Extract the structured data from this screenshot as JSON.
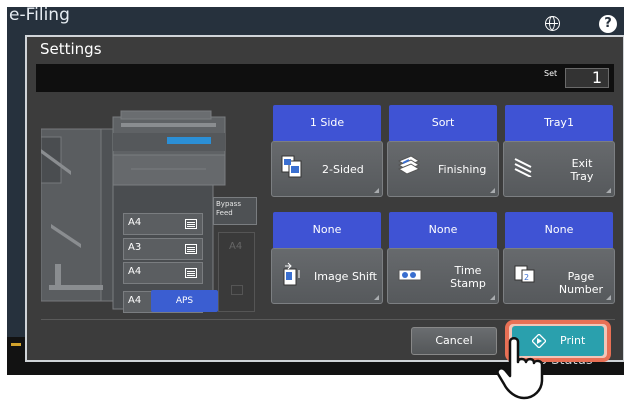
{
  "app": {
    "title": "e-Filing",
    "help_label": "?"
  },
  "icons": {
    "globe": "globe-icon",
    "help": "help-icon",
    "hand": "hand-pointer-icon"
  },
  "dialog": {
    "title": "Settings",
    "set_label": "Set",
    "set_value": "1"
  },
  "machine": {
    "trays": [
      {
        "label": "A4"
      },
      {
        "label": "A3"
      },
      {
        "label": "A4"
      },
      {
        "label": "A4"
      }
    ],
    "bypass_label": "Bypass Feed",
    "bypass_size": "A4",
    "aps_label": "APS"
  },
  "functions": [
    {
      "value": "1 Side",
      "label": "2-Sided",
      "icon": "duplex-icon"
    },
    {
      "value": "Sort",
      "label": "Finishing",
      "icon": "finishing-icon"
    },
    {
      "value": "Tray1",
      "label": "Exit Tray",
      "icon": "exit-tray-icon"
    },
    {
      "value": "None",
      "label": "Image Shift",
      "icon": "image-shift-icon"
    },
    {
      "value": "None",
      "label": "Time Stamp",
      "icon": "time-stamp-icon"
    },
    {
      "value": "None",
      "label": "Page Number",
      "icon": "page-number-icon"
    }
  ],
  "actions": {
    "cancel": "Cancel",
    "print": "Print"
  },
  "footer": {
    "job_status": "Job Status"
  },
  "colors": {
    "accent_blue": "#3f53d4",
    "print_teal": "#2aa0ad",
    "highlight": "#e87055"
  }
}
